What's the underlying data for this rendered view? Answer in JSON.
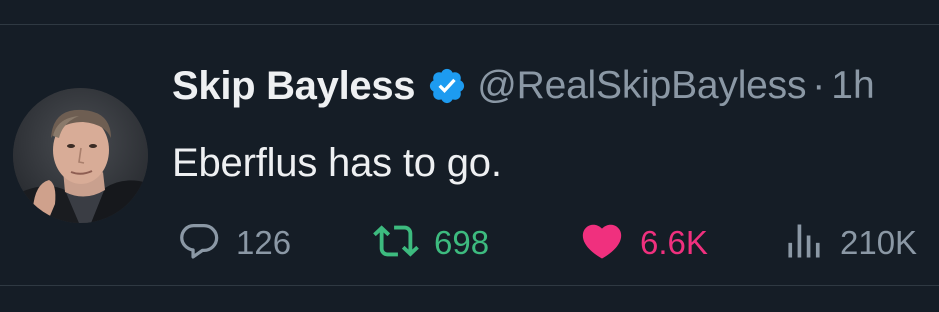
{
  "tweet": {
    "author": {
      "display_name": "Skip Bayless",
      "handle": "@RealSkipBayless",
      "verified": true,
      "verified_icon": "verified-badge-icon",
      "avatar": "profile-photo"
    },
    "separator": "·",
    "time": "1h",
    "text": "Eberflus has to go.",
    "actions": {
      "reply": {
        "icon": "reply-icon",
        "count": "126"
      },
      "retweet": {
        "icon": "retweet-icon",
        "count": "698",
        "active": true
      },
      "like": {
        "icon": "heart-icon",
        "count": "6.6K",
        "active": true
      },
      "views": {
        "icon": "views-chart-icon",
        "count": "210K"
      }
    }
  },
  "colors": {
    "background": "#151d26",
    "text_primary": "#eef0f2",
    "text_secondary": "#8b98a5",
    "verified_blue": "#1d9bf0",
    "retweet_green": "#3dbb7f",
    "like_pink": "#f0307e",
    "divider": "#2f3942"
  }
}
